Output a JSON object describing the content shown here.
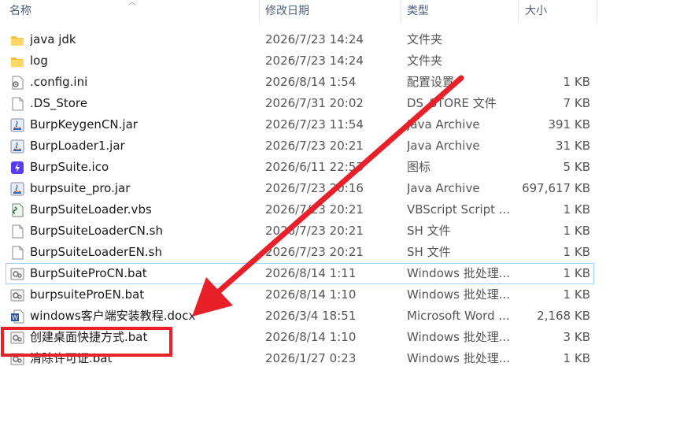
{
  "columns": {
    "name": "名称",
    "date": "修改日期",
    "type": "类型",
    "size": "大小"
  },
  "files": [
    {
      "name": "java jdk",
      "date": "2026/7/23 14:24",
      "type": "文件夹",
      "size": "",
      "icon": "folder-icon"
    },
    {
      "name": "log",
      "date": "2026/7/23 14:24",
      "type": "文件夹",
      "size": "",
      "icon": "folder-icon"
    },
    {
      "name": ".config.ini",
      "date": "2026/8/14 1:54",
      "type": "配置设置",
      "size": "1 KB",
      "icon": "config-file-icon"
    },
    {
      "name": ".DS_Store",
      "date": "2026/7/31 20:02",
      "type": "DS_STORE 文件",
      "size": "7 KB",
      "icon": "blank-file-icon"
    },
    {
      "name": "BurpKeygenCN.jar",
      "date": "2026/7/23 11:54",
      "type": "Java Archive",
      "size": "391 KB",
      "icon": "java-archive-icon"
    },
    {
      "name": "BurpLoader1.jar",
      "date": "2026/7/23 20:21",
      "type": "Java Archive",
      "size": "31 KB",
      "icon": "java-archive-icon"
    },
    {
      "name": "BurpSuite.ico",
      "date": "2026/6/11 22:53",
      "type": "图标",
      "size": "5 KB",
      "icon": "burp-ico-icon"
    },
    {
      "name": "burpsuite_pro.jar",
      "date": "2026/7/23 20:16",
      "type": "Java Archive",
      "size": "697,617 KB",
      "icon": "java-archive-icon"
    },
    {
      "name": "BurpSuiteLoader.vbs",
      "date": "2026/7/23 20:21",
      "type": "VBScript Script ...",
      "size": "1 KB",
      "icon": "vbscript-icon"
    },
    {
      "name": "BurpSuiteLoaderCN.sh",
      "date": "2026/7/23 20:21",
      "type": "SH 文件",
      "size": "1 KB",
      "icon": "blank-file-icon"
    },
    {
      "name": "BurpSuiteLoaderEN.sh",
      "date": "2026/7/23 20:21",
      "type": "SH 文件",
      "size": "1 KB",
      "icon": "blank-file-icon"
    },
    {
      "name": "BurpSuiteProCN.bat",
      "date": "2026/8/14 1:11",
      "type": "Windows 批处理...",
      "size": "1 KB",
      "icon": "batch-file-icon"
    },
    {
      "name": "burpsuiteProEN.bat",
      "date": "2026/8/14 1:10",
      "type": "Windows 批处理...",
      "size": "1 KB",
      "icon": "batch-file-icon"
    },
    {
      "name": "windows客户端安装教程.docx",
      "date": "2026/3/4 18:51",
      "type": "Microsoft Word ...",
      "size": "2,168 KB",
      "icon": "word-doc-icon"
    },
    {
      "name": "创建桌面快捷方式.bat",
      "date": "2026/8/14 1:10",
      "type": "Windows 批处理...",
      "size": "3 KB",
      "icon": "batch-file-icon"
    },
    {
      "name": "清除许可证.bat",
      "date": "2026/1/27 0:23",
      "type": "Windows 批处理...",
      "size": "1 KB",
      "icon": "batch-file-icon"
    }
  ],
  "selected_index": 11,
  "annotation": {
    "highlight_index": 14,
    "color": "#e8202a"
  }
}
